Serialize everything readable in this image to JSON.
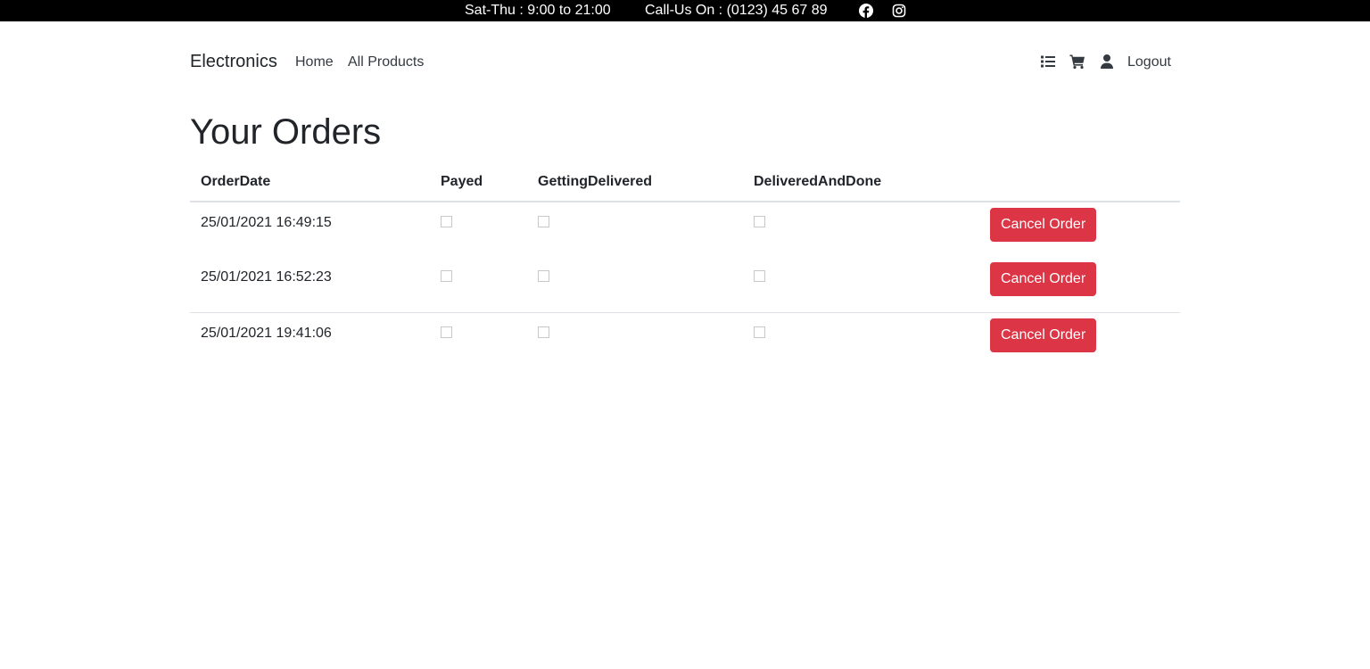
{
  "topbar": {
    "hours": "Sat-Thu : 9:00 to 21:00",
    "phone": "Call-Us On : (0123) 45 67 89",
    "icons": [
      "facebook-icon",
      "instagram-icon"
    ]
  },
  "navbar": {
    "brand": "Electronics",
    "links": [
      "Home",
      "All Products"
    ],
    "icons": [
      "list-icon",
      "cart-icon",
      "user-icon"
    ],
    "logout": "Logout"
  },
  "main": {
    "title": "Your Orders",
    "table": {
      "headers": [
        "OrderDate",
        "Payed",
        "GettingDelivered",
        "DeliveredAndDone",
        ""
      ],
      "rows": [
        {
          "date": "25/01/2021 16:49:15",
          "payed": false,
          "getting_delivered": false,
          "delivered_and_done": false,
          "action": "Cancel Order"
        },
        {
          "date": "25/01/2021 16:52:23",
          "payed": false,
          "getting_delivered": false,
          "delivered_and_done": false,
          "action": "Cancel Order"
        },
        {
          "date": "25/01/2021 19:41:06",
          "payed": false,
          "getting_delivered": false,
          "delivered_and_done": false,
          "action": "Cancel Order"
        }
      ]
    }
  },
  "colors": {
    "topbar_bg": "#000000",
    "danger": "#dc3545",
    "text": "#212529",
    "border": "#dee2e6"
  }
}
